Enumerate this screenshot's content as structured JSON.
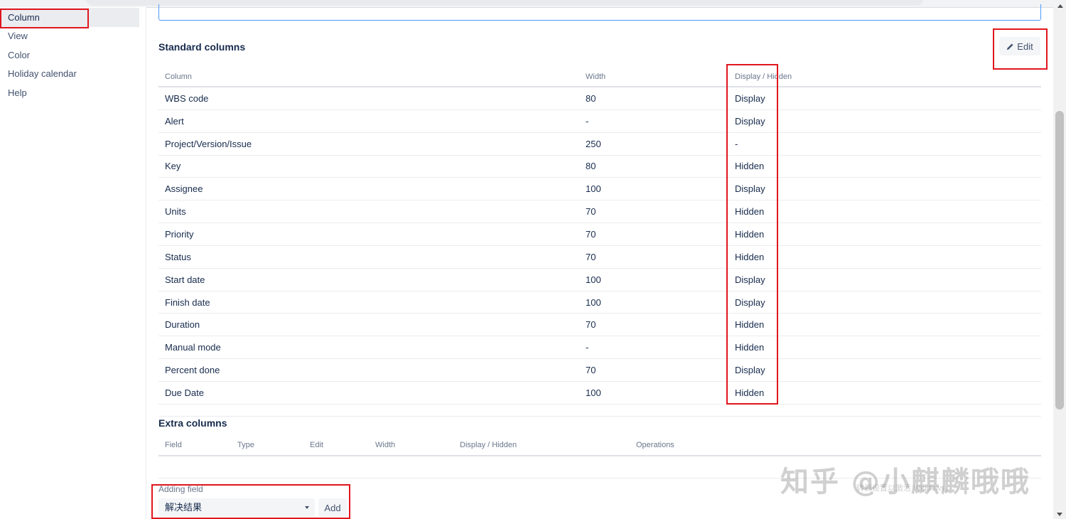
{
  "sidebar": {
    "items": [
      {
        "label": "Column",
        "active": true
      },
      {
        "label": "View"
      },
      {
        "label": "Color"
      },
      {
        "label": "Holiday calendar"
      },
      {
        "label": "Help"
      }
    ]
  },
  "standard": {
    "title": "Standard columns",
    "edit_label": "Edit",
    "headers": [
      "Column",
      "Width",
      "Display / Hidden"
    ],
    "rows": [
      {
        "column": "WBS code",
        "width": "80",
        "display": "Display"
      },
      {
        "column": "Alert",
        "width": "-",
        "display": "Display"
      },
      {
        "column": "Project/Version/Issue",
        "width": "250",
        "display": "-"
      },
      {
        "column": "Key",
        "width": "80",
        "display": "Hidden"
      },
      {
        "column": "Assignee",
        "width": "100",
        "display": "Display"
      },
      {
        "column": "Units",
        "width": "70",
        "display": "Hidden"
      },
      {
        "column": "Priority",
        "width": "70",
        "display": "Hidden"
      },
      {
        "column": "Status",
        "width": "70",
        "display": "Hidden"
      },
      {
        "column": "Start date",
        "width": "100",
        "display": "Display"
      },
      {
        "column": "Finish date",
        "width": "100",
        "display": "Display"
      },
      {
        "column": "Duration",
        "width": "70",
        "display": "Hidden"
      },
      {
        "column": "Manual mode",
        "width": "-",
        "display": "Hidden"
      },
      {
        "column": "Percent done",
        "width": "70",
        "display": "Display"
      },
      {
        "column": "Due Date",
        "width": "100",
        "display": "Hidden"
      }
    ]
  },
  "extra": {
    "title": "Extra columns",
    "headers": [
      "Field",
      "Type",
      "Edit",
      "Width",
      "Display / Hidden",
      "Operations"
    ]
  },
  "adding": {
    "label": "Adding field",
    "selected": "解决结果",
    "add_label": "Add"
  },
  "watermark": {
    "text": "知乎 @小麒麟哦哦",
    "sub": "转到设置以激活 Windows。"
  },
  "colors": {
    "highlight": "#e0161d",
    "accent": "#4c9aff"
  }
}
